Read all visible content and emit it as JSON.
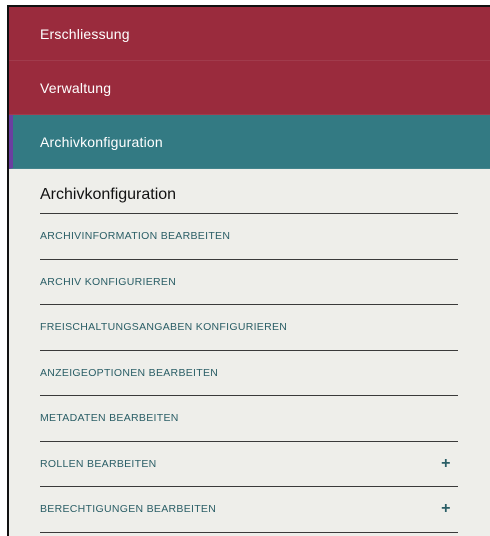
{
  "nav": {
    "items": [
      {
        "label": "Erschliessung",
        "color": "#9a2b3d"
      },
      {
        "label": "Verwaltung",
        "color": "#9a2b3d"
      },
      {
        "label": "Archivkonfiguration",
        "color": "#337a83",
        "active": true
      }
    ]
  },
  "section": {
    "title": "Archivkonfiguration",
    "items": [
      {
        "label": "ARCHIVINFORMATION BEARBEITEN",
        "expandable": false
      },
      {
        "label": "ARCHIV KONFIGURIEREN",
        "expandable": false
      },
      {
        "label": "FREISCHALTUNGSANGABEN KONFIGURIEREN",
        "expandable": false
      },
      {
        "label": "ANZEIGEOPTIONEN BEARBEITEN",
        "expandable": false
      },
      {
        "label": "METADATEN BEARBEITEN",
        "expandable": false
      },
      {
        "label": "ROLLEN BEARBEITEN",
        "expandable": true,
        "icon": "+"
      },
      {
        "label": "BERECHTIGUNGEN BEARBEITEN",
        "expandable": true,
        "icon": "+"
      }
    ]
  },
  "colors": {
    "nav_red": "#9a2b3d",
    "nav_teal": "#337a83",
    "active_marker": "#6b3fa0",
    "link_text": "#2a5e66",
    "panel_bg": "#eeeeea"
  }
}
